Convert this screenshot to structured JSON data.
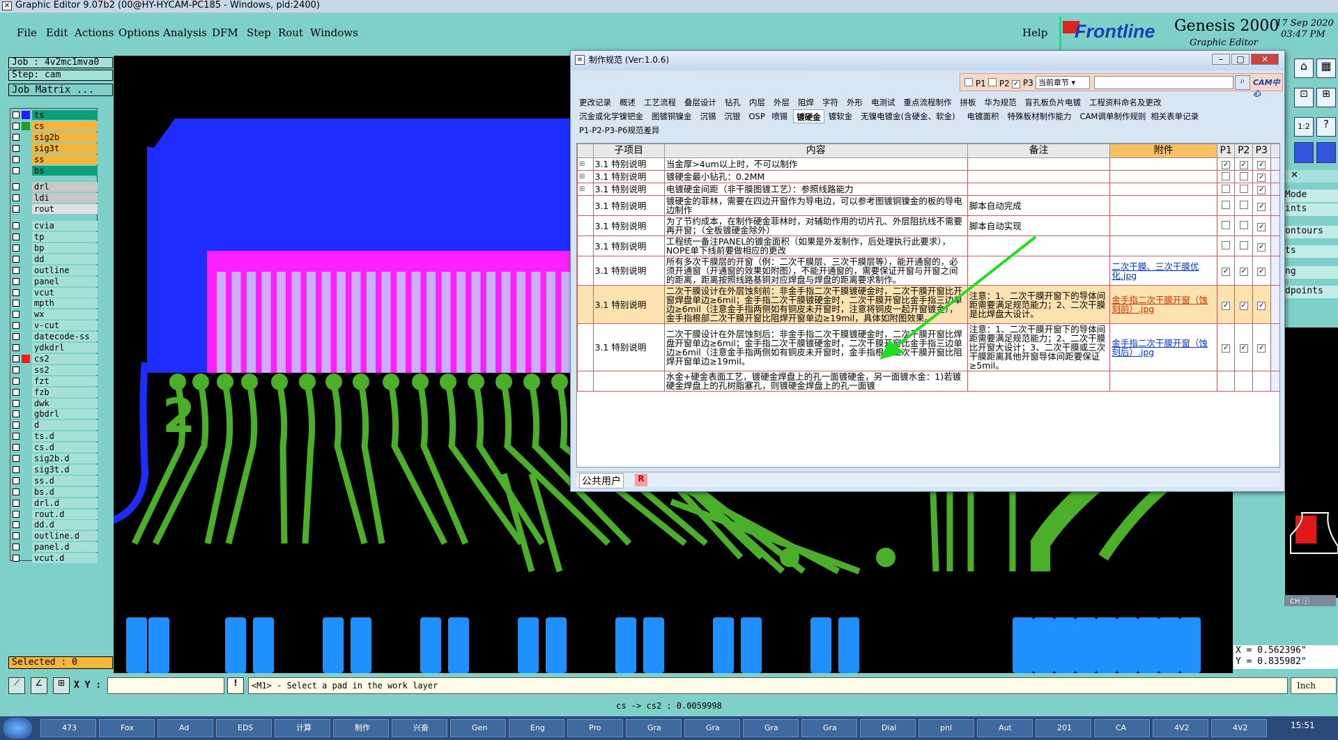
{
  "window": {
    "title": "Graphic Editor 9.07b2 (00@HY-HYCAM-PC185 - Windows, pid:2400)"
  },
  "menu": [
    "File",
    "Edit",
    "Actions",
    "Options",
    "Analysis",
    "DFM",
    "Step",
    "Rout",
    "Windows"
  ],
  "help": "Help",
  "brand": {
    "logo": "Frontline",
    "product": "Genesis 2000",
    "sub": "Graphic Editor",
    "date": "17 Sep 2020",
    "time": "03:47 PM"
  },
  "left": {
    "job": "Job : 4v2mc1mva0",
    "step": "Step: cam",
    "job_matrix": "Job Matrix ...",
    "selected": "Selected : 0"
  },
  "layers": [
    {
      "name": "ts",
      "color": "#1f1fff",
      "bg": "#0b9f7a"
    },
    {
      "name": "cs",
      "color": "#1fa01f",
      "bg": "#f6b43a"
    },
    {
      "name": "sig2b",
      "color": "",
      "bg": "#f6b43a"
    },
    {
      "name": "sig3t",
      "color": "",
      "bg": "#f6b43a"
    },
    {
      "name": "ss",
      "color": "",
      "bg": "#f6b43a"
    },
    {
      "name": "bs",
      "color": "",
      "bg": "#0b9f7a"
    },
    {
      "name": "drl",
      "color": "",
      "bg": "#c8c8c8"
    },
    {
      "name": "ldi",
      "color": "",
      "bg": "#c8c8c8"
    },
    {
      "name": "rout",
      "color": "",
      "bg": "#e0e0e0"
    },
    {
      "name": "cvia",
      "color": "",
      "bg": "#a6e0da"
    },
    {
      "name": "tp",
      "color": "",
      "bg": "#a6e0da"
    },
    {
      "name": "bp",
      "color": "",
      "bg": "#a6e0da"
    },
    {
      "name": "dd",
      "color": "",
      "bg": "#a6e0da"
    },
    {
      "name": "outline",
      "color": "",
      "bg": "#a6e0da"
    },
    {
      "name": "panel",
      "color": "",
      "bg": "#a6e0da"
    },
    {
      "name": "vcut",
      "color": "",
      "bg": "#a6e0da"
    },
    {
      "name": "mpth",
      "color": "",
      "bg": "#a6e0da"
    },
    {
      "name": "wx",
      "color": "",
      "bg": "#a6e0da"
    },
    {
      "name": "v-cut",
      "color": "",
      "bg": "#a6e0da"
    },
    {
      "name": "datecode-ss",
      "color": "",
      "bg": "#a6e0da"
    },
    {
      "name": "ydkdrl",
      "color": "",
      "bg": "#a6e0da"
    },
    {
      "name": "cs2",
      "color": "#ff1a1a",
      "bg": "#a6e0da"
    },
    {
      "name": "ss2",
      "color": "",
      "bg": "#a6e0da"
    },
    {
      "name": "fzt",
      "color": "",
      "bg": "#a6e0da"
    },
    {
      "name": "fzb",
      "color": "",
      "bg": "#a6e0da"
    },
    {
      "name": "dwk",
      "color": "",
      "bg": "#a6e0da"
    },
    {
      "name": "gbdrl",
      "color": "",
      "bg": "#a6e0da"
    },
    {
      "name": "d",
      "color": "",
      "bg": "#a6e0da"
    },
    {
      "name": "ts.d",
      "color": "",
      "bg": "#a6e0da"
    },
    {
      "name": "cs.d",
      "color": "",
      "bg": "#a6e0da"
    },
    {
      "name": "sig2b.d",
      "color": "",
      "bg": "#a6e0da"
    },
    {
      "name": "sig3t.d",
      "color": "",
      "bg": "#a6e0da"
    },
    {
      "name": "ss.d",
      "color": "",
      "bg": "#a6e0da"
    },
    {
      "name": "bs.d",
      "color": "",
      "bg": "#a6e0da"
    },
    {
      "name": "drl.d",
      "color": "",
      "bg": "#a6e0da"
    },
    {
      "name": "rout.d",
      "color": "",
      "bg": "#a6e0da"
    },
    {
      "name": "dd.d",
      "color": "",
      "bg": "#a6e0da"
    },
    {
      "name": "outline.d",
      "color": "",
      "bg": "#a6e0da"
    },
    {
      "name": "panel.d",
      "color": "",
      "bg": "#a6e0da"
    },
    {
      "name": "vcut.d",
      "color": "",
      "bg": "#a6e0da"
    }
  ],
  "canvas": {
    "digit": "2",
    "colors": {
      "board": "#1f2cff",
      "pads": "#ff1fff",
      "fingers": "#c8b0ff",
      "traces": "#4caf2a",
      "bottompads": "#1e90ff",
      "arrow": "#22dd22"
    }
  },
  "right": {
    "items": [
      "Mode",
      "ints",
      "ontours",
      "ts",
      "ng",
      "dpoints"
    ],
    "coord_x": "X = 0.562396\"",
    "coord_y": "Y = 0.835982\"",
    "units": "Inch",
    "ratio": "1:2",
    "ch": "CH"
  },
  "status": {
    "xy_label": "X Y :",
    "xy_value": "",
    "message": "<M1> - Select a pad in the work layer",
    "bottom": "cs -> cs2 : 0.0059998"
  },
  "taskbar": {
    "items": [
      "473",
      "Fox",
      "Ad",
      "EDS",
      "计算",
      "制作",
      "兴奋",
      "Gen",
      "Eng",
      "Pro",
      "Gra",
      "Gra",
      "Gra",
      "Gra",
      "Dial",
      "pnl",
      "Aut",
      "201",
      "CA",
      "4V2",
      "4V2"
    ],
    "time": "15:51"
  },
  "dialog": {
    "title": "制作规范 (Ver:1.0.6)",
    "filters": {
      "p1": "P1",
      "p2": "P2",
      "p3": "P3",
      "scope": "当前章节",
      "search": "",
      "badge": "CAM中心"
    },
    "tabs_row1": [
      "更改记录",
      "概述",
      "工艺流程",
      "叠层设计",
      "钻孔",
      "内层",
      "外层",
      "阻焊",
      "字符",
      "外形",
      "电测试",
      "重点流程制作",
      "拼板",
      "华为规范",
      "盲孔板负片电镀",
      "工程资料命名及更改"
    ],
    "tabs_row2": [
      "沉金或化学镍钯金",
      "图镀铜镍金",
      "沉锡",
      "沉银",
      "OSP",
      "喷锡",
      "镀硬金",
      "镀软金",
      "无镍电镀金(含硬金、软金)",
      "电镀面积",
      "特殊板材制作能力",
      "CAM调单制作规则",
      "相关表单记录"
    ],
    "active_tab": "镀硬金",
    "tabs_row3": [
      "P1-P2-P3-P6规范差异"
    ],
    "headers": [
      "子项目",
      "内容",
      "备注",
      "附件",
      "P1",
      "P2",
      "P3"
    ],
    "rows": [
      {
        "item": "3.1 特别说明",
        "content": "当金厚>4um以上时，不可以制作",
        "note": "",
        "attach": "",
        "p": [
          true,
          true,
          true
        ]
      },
      {
        "item": "3.1 特别说明",
        "content": "镀硬金最小钻孔：0.2MM",
        "note": "",
        "attach": "",
        "p": [
          false,
          false,
          true
        ]
      },
      {
        "item": "3.1 特别说明",
        "content": "电镀硬金间距（非干膜图镀工艺）：参照线路能力",
        "note": "",
        "attach": "",
        "p": [
          false,
          false,
          true
        ]
      },
      {
        "item": "3.1 特别说明",
        "content": "镀硬金的菲林，需要在四边开窗作为导电边，可以参考图镀铜镍金的板的导电边制作",
        "note": "脚本自动完成",
        "attach": "",
        "p": [
          false,
          false,
          true
        ]
      },
      {
        "item": "3.1 特别说明",
        "content": "为了节约成本，在制作硬金菲林时，对辅助作用的切片孔、外层阻抗线不需要再开窗；（全板镀硬金除外）",
        "note": "脚本自动实现",
        "attach": "",
        "p": [
          false,
          false,
          true
        ]
      },
      {
        "item": "3.1 特别说明",
        "content": "工程统一备注PANEL的镀金面积（如果是外发制作，后处理执行此要求），NOPE单下线前要做相应的更改",
        "note": "",
        "attach": "",
        "p": [
          false,
          false,
          true
        ]
      },
      {
        "item": "3.1 特别说明",
        "content": "所有多次干膜层的开窗（例：二次干膜层、三次干膜层等），能开通窗的，必须开通窗（开通窗的效果如附图），不能开通窗的，需要保证开窗与开窗之间的距离，距离按照线路基铜对应焊盘与焊盘的距离要求制作。",
        "note": "",
        "attach": "二次干膜、三次干膜优化.jpg",
        "p": [
          true,
          true,
          true
        ]
      },
      {
        "item": "3.1 特别说明",
        "content": "二次干膜设计在外层蚀刻前：非金手指二次干膜镀硬金时，二次干膜开窗比开窗焊盘单边≥6mil；金手指二次干膜镀硬金时，二次干膜开窗比金手指三边单边≥6mil（注意金手指两侧如有铜皮未开窗时，注意将铜皮一起开窗镀金），金手指根部二次干膜开窗比阻焊开窗单边≥19mil，具体如附图效果。",
        "note": "注意：1、二次干膜开窗下的导体间距需要满足规范能力；2、二次干膜是比焊盘大设计。",
        "attach": "金手指二次干膜开窗（蚀刻前）.jpg",
        "p": [
          true,
          true,
          true
        ],
        "highlight": true
      },
      {
        "item": "3.1 特别说明",
        "content": "二次干膜设计在外层蚀刻后：非金手指二次干膜镀硬金时，二次干膜开窗比焊盘开窗单边≥6mil；金手指二次干膜镀硬金时，二次干膜开窗比金手指三边单边≥6mil（注意金手指两侧如有铜皮未开窗时，金手指根部二次干膜开窗比阻焊开窗单边≥19mil。",
        "note": "注意：1、二次干膜开窗下的导体间距需要满足规范能力；2、二次干膜比开窗大设计；3、二次干膜或三次干膜距离其他开窗导体间距要保证≥5mil。",
        "attach": "金手指二次干膜开窗（蚀刻后）.jpg",
        "p": [
          true,
          true,
          true
        ]
      },
      {
        "item": "",
        "content": "水金+硬金表面工艺，镀硬金焊盘上的孔一面镀硬金，另一面镀水金：1)若镀硬金焊盘上的孔树脂塞孔，则镀硬金焊盘上的孔一面镀",
        "note": "",
        "attach": "",
        "p": [
          null,
          null,
          null
        ]
      }
    ],
    "footer_user": "公共用户",
    "footer_r": "R"
  }
}
